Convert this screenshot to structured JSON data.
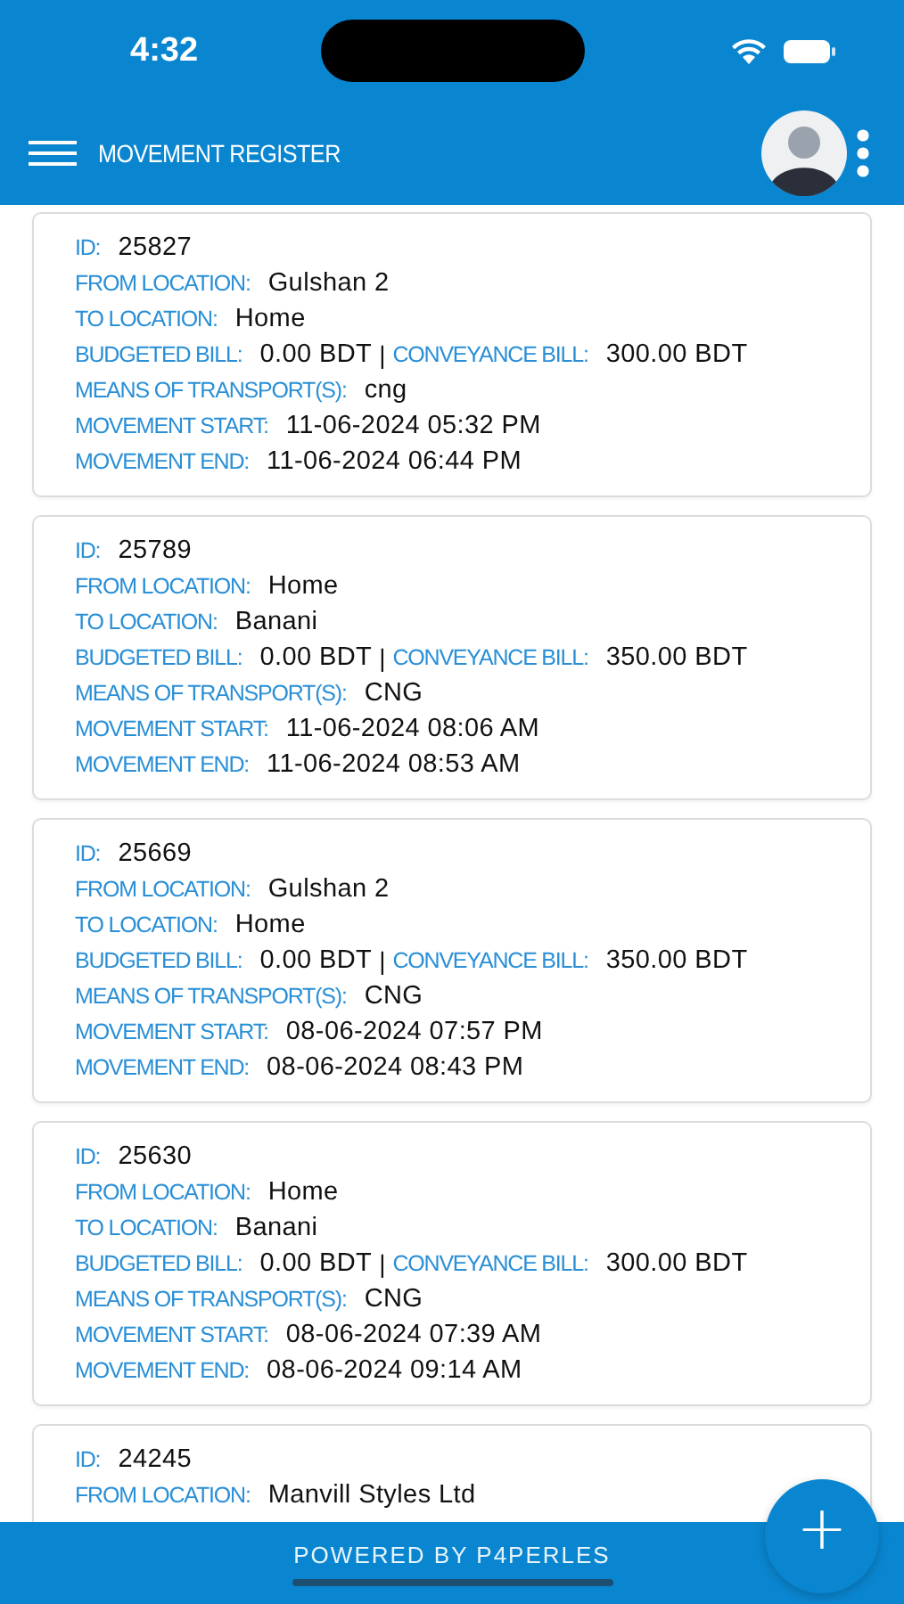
{
  "status_bar": {
    "time": "4:32"
  },
  "app_bar": {
    "title": "MOVEMENT REGISTER"
  },
  "records": [
    {
      "rows": [
        {
          "kind": "single",
          "label": "ID:",
          "value": "25827"
        },
        {
          "kind": "single",
          "label": "FROM LOCATION:",
          "value": "Gulshan 2"
        },
        {
          "kind": "single",
          "label": "TO LOCATION:",
          "value": "Home"
        },
        {
          "kind": "double",
          "label": "BUDGETED BILL:",
          "value": "0.00 BDT",
          "separator": "|",
          "label2": "CONVEYANCE BILL:",
          "value2": "300.00 BDT"
        },
        {
          "kind": "single",
          "label": "MEANS OF TRANSPORT(S):",
          "value": "cng"
        },
        {
          "kind": "single",
          "label": "MOVEMENT START:",
          "value": "11-06-2024 05:32 PM"
        },
        {
          "kind": "single",
          "label": "MOVEMENT END:",
          "value": "11-06-2024 06:44 PM"
        }
      ]
    },
    {
      "rows": [
        {
          "kind": "single",
          "label": "ID:",
          "value": "25789"
        },
        {
          "kind": "single",
          "label": "FROM LOCATION:",
          "value": "Home"
        },
        {
          "kind": "single",
          "label": "TO LOCATION:",
          "value": "Banani"
        },
        {
          "kind": "double",
          "label": "BUDGETED BILL:",
          "value": "0.00 BDT",
          "separator": "|",
          "label2": "CONVEYANCE BILL:",
          "value2": "350.00 BDT"
        },
        {
          "kind": "single",
          "label": "MEANS OF TRANSPORT(S):",
          "value": "CNG"
        },
        {
          "kind": "single",
          "label": "MOVEMENT START:",
          "value": "11-06-2024 08:06 AM"
        },
        {
          "kind": "single",
          "label": "MOVEMENT END:",
          "value": "11-06-2024 08:53 AM"
        }
      ]
    },
    {
      "rows": [
        {
          "kind": "single",
          "label": "ID:",
          "value": "25669"
        },
        {
          "kind": "single",
          "label": "FROM LOCATION:",
          "value": "Gulshan 2"
        },
        {
          "kind": "single",
          "label": "TO LOCATION:",
          "value": "Home"
        },
        {
          "kind": "double",
          "label": "BUDGETED BILL:",
          "value": "0.00 BDT",
          "separator": "|",
          "label2": "CONVEYANCE BILL:",
          "value2": "350.00 BDT"
        },
        {
          "kind": "single",
          "label": "MEANS OF TRANSPORT(S):",
          "value": "CNG"
        },
        {
          "kind": "single",
          "label": "MOVEMENT START:",
          "value": "08-06-2024 07:57 PM"
        },
        {
          "kind": "single",
          "label": "MOVEMENT END:",
          "value": "08-06-2024 08:43 PM"
        }
      ]
    },
    {
      "rows": [
        {
          "kind": "single",
          "label": "ID:",
          "value": "25630"
        },
        {
          "kind": "single",
          "label": "FROM LOCATION:",
          "value": "Home"
        },
        {
          "kind": "single",
          "label": "TO LOCATION:",
          "value": "Banani"
        },
        {
          "kind": "double",
          "label": "BUDGETED BILL:",
          "value": "0.00 BDT",
          "separator": "|",
          "label2": "CONVEYANCE BILL:",
          "value2": "300.00 BDT"
        },
        {
          "kind": "single",
          "label": "MEANS OF TRANSPORT(S):",
          "value": "CNG"
        },
        {
          "kind": "single",
          "label": "MOVEMENT START:",
          "value": "08-06-2024 07:39 AM"
        },
        {
          "kind": "single",
          "label": "MOVEMENT END:",
          "value": "08-06-2024 09:14 AM"
        }
      ]
    },
    {
      "rows": [
        {
          "kind": "single",
          "label": "ID:",
          "value": "24245"
        },
        {
          "kind": "single",
          "label": "FROM LOCATION:",
          "value": "Manvill Styles Ltd"
        }
      ]
    }
  ],
  "footer": {
    "text": "POWERED BY P4PERLES"
  },
  "fab": {
    "label": "+"
  }
}
